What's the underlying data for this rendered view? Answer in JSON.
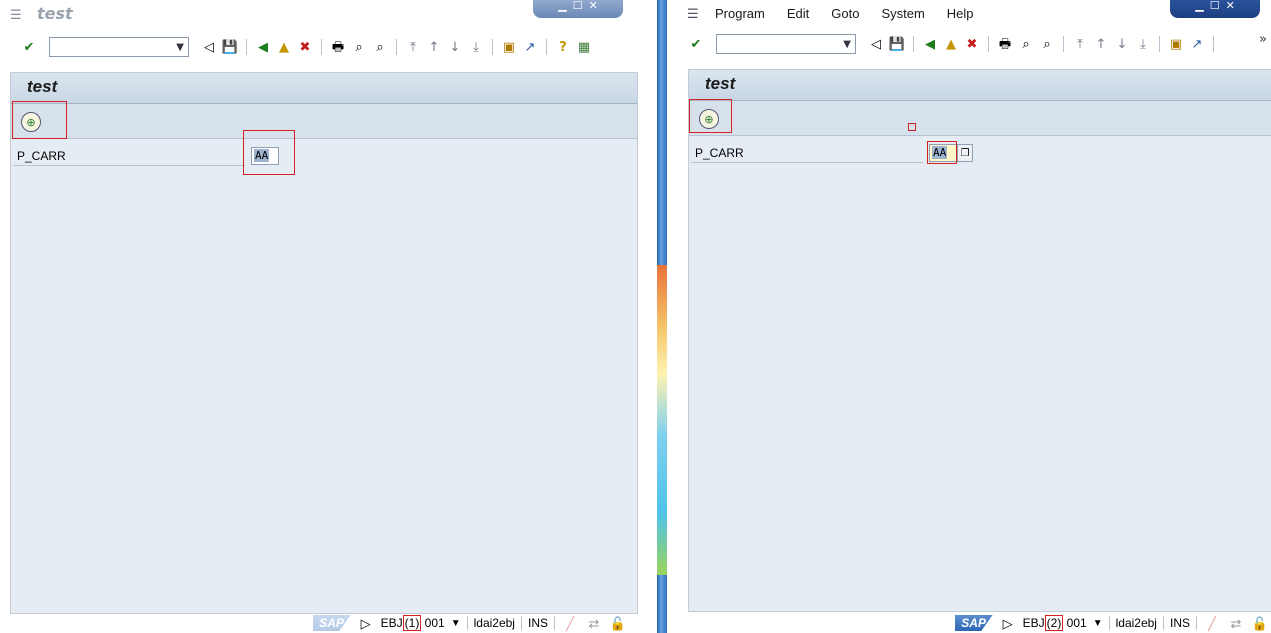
{
  "left": {
    "title": "test",
    "screen_title": "test",
    "field_label": "P_CARR",
    "field_value": "AA",
    "status": {
      "system": "EBJ",
      "session": "(1)",
      "client": "001",
      "server": "ldai2ebj",
      "mode": "INS"
    }
  },
  "right": {
    "menus": [
      "Program",
      "Edit",
      "Goto",
      "System",
      "Help"
    ],
    "screen_title": "test",
    "field_label": "P_CARR",
    "field_value": "AA",
    "more_glyph": "»",
    "status": {
      "system": "EBJ",
      "session": "(2)",
      "client": "001",
      "server": "ldai2ebj",
      "mode": "INS"
    }
  },
  "sap_logo": "SAP",
  "icons": {
    "enter": "✔",
    "dropdown": "▼",
    "back_nav": "◁",
    "save": "💾",
    "back": "◀",
    "exit": "▲",
    "cancel": "✖",
    "print": "🖶",
    "find": "⌕",
    "find_next": "⌕",
    "first_page": "⤒",
    "prev_page": "↑",
    "next_page": "↓",
    "last_page": "⤓",
    "new_session": "▣",
    "shortcut": "↗",
    "help": "?",
    "layout": "▦",
    "execute": "⊕",
    "f4": "❐",
    "play": "▷",
    "lock": "🔓"
  },
  "colors": {
    "highlight": "#d42222",
    "screen_bg": "#e5ecf3",
    "selection": "#9eb3d0"
  }
}
